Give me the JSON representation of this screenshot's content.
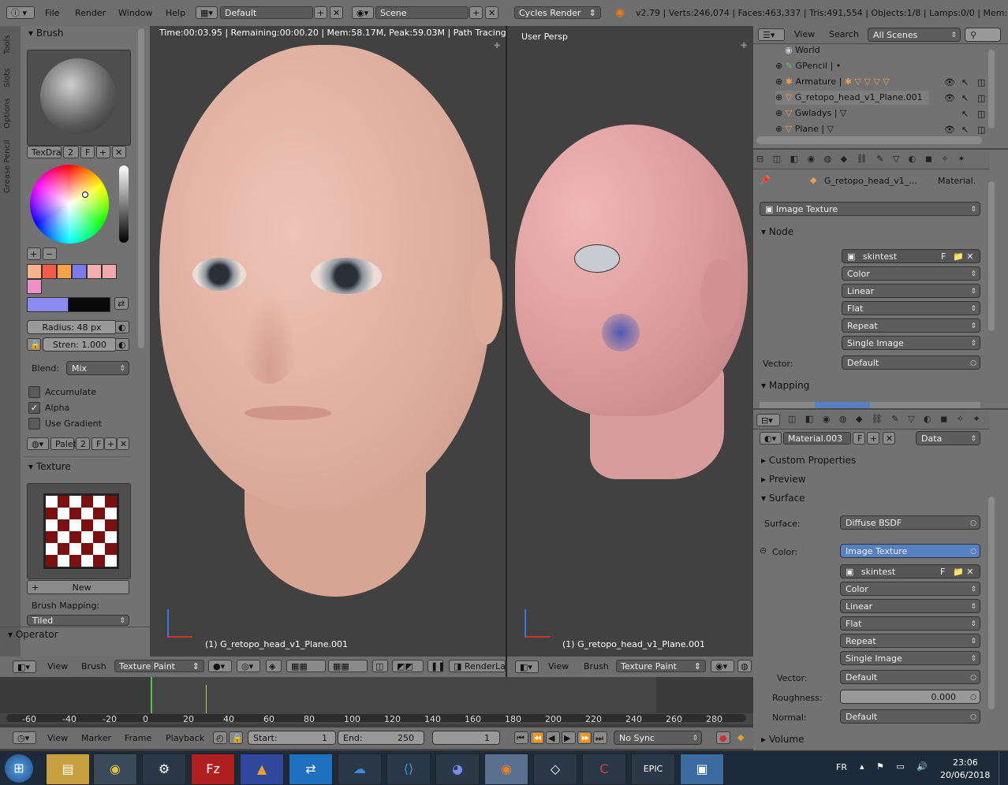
{
  "topbar": {
    "menus": [
      "File",
      "Render",
      "Window",
      "Help"
    ],
    "layout": "Default",
    "scene": "Scene",
    "engine": "Cycles Render",
    "stats": "v2.79 | Verts:246,074 | Faces:463,337 | Tris:491,554 | Objects:1/8 | Lamps:0/0 | Mem:197."
  },
  "tool_tabs": [
    "Tools",
    "Slots",
    "Options",
    "Grease Pencil"
  ],
  "brush_panel": {
    "header": "Brush",
    "brush_name": "TexDra",
    "brush_users": "2",
    "fake": "F",
    "radius_label": "Radius:",
    "radius_value": "48 px",
    "strength_label": "Stren:",
    "strength_value": "1.000",
    "blend_label": "Blend:",
    "blend_value": "Mix",
    "accumulate": "Accumulate",
    "alpha": "Alpha",
    "use_gradient": "Use Gradient",
    "palette_name": "Palet",
    "palette_users": "2",
    "swatches": [
      "#f5b48a",
      "#f25a4a",
      "#f5a24a",
      "#7a7ae8",
      "#f5b0b0",
      "#f5a8a8",
      "#f090c8"
    ],
    "primary_color": "#8c8cf0",
    "secondary_color": "#0a0a0a"
  },
  "texture_panel": {
    "header": "Texture",
    "new_label": "New",
    "mapping_label": "Brush Mapping:",
    "mapping_value": "Tiled"
  },
  "operator_header": "Operator",
  "viewport_left": {
    "status": "Time:00:03.95 | Remaining:00:00.20 | Mem:58.17M, Peak:59.03M | Path Tracing Sampl",
    "object_label": "(1) G_retopo_head_v1_Plane.001"
  },
  "viewport_right": {
    "view_label": "User Persp",
    "object_label": "(1) G_retopo_head_v1_Plane.001"
  },
  "viewport_header": {
    "view": "View",
    "brush": "Brush",
    "mode": "Texture Paint",
    "render_layer": "RenderLa"
  },
  "outliner": {
    "view": "View",
    "search": "Search",
    "filter": "All Scenes",
    "items": [
      "World",
      "GPencil",
      "Armature",
      "G_retopo_head_v1_Plane.001",
      "Gwladys",
      "Plane"
    ]
  },
  "node_panel": {
    "breadcrumb_object": "G_retopo_head_v1_...",
    "breadcrumb_material": "Material.",
    "node_type": "Image Texture",
    "node_header": "Node",
    "image_name": "skintest",
    "fake": "F",
    "options": [
      "Color",
      "Linear",
      "Flat",
      "Repeat",
      "Single Image"
    ],
    "vector_label": "Vector:",
    "vector_value": "Default",
    "mapping_header": "Mapping"
  },
  "material_panel": {
    "material_name": "Material.003",
    "fake": "F",
    "data_dropdown": "Data",
    "custom_properties": "Custom Properties",
    "preview": "Preview",
    "surface_header": "Surface",
    "surface_label": "Surface:",
    "surface_value": "Diffuse BSDF",
    "color_label": "Color:",
    "color_value": "Image Texture",
    "image_name": "skintest",
    "options": [
      "Color",
      "Linear",
      "Flat",
      "Repeat",
      "Single Image"
    ],
    "vector_label": "Vector:",
    "vector_value": "Default",
    "roughness_label": "Roughness:",
    "roughness_value": "0.000",
    "normal_label": "Normal:",
    "normal_value": "Default",
    "volume_header": "Volume"
  },
  "timeline": {
    "ticks": [
      "-60",
      "-40",
      "-20",
      "0",
      "20",
      "40",
      "60",
      "80",
      "100",
      "120",
      "140",
      "160",
      "180",
      "200",
      "220",
      "240",
      "260",
      "280"
    ],
    "menus": [
      "View",
      "Marker",
      "Frame",
      "Playback"
    ],
    "start_label": "Start:",
    "start_value": "1",
    "end_label": "End:",
    "end_value": "250",
    "current_frame": "1",
    "sync": "No Sync"
  },
  "taskbar": {
    "lang": "FR",
    "time": "23:06",
    "date": "20/06/2018"
  }
}
